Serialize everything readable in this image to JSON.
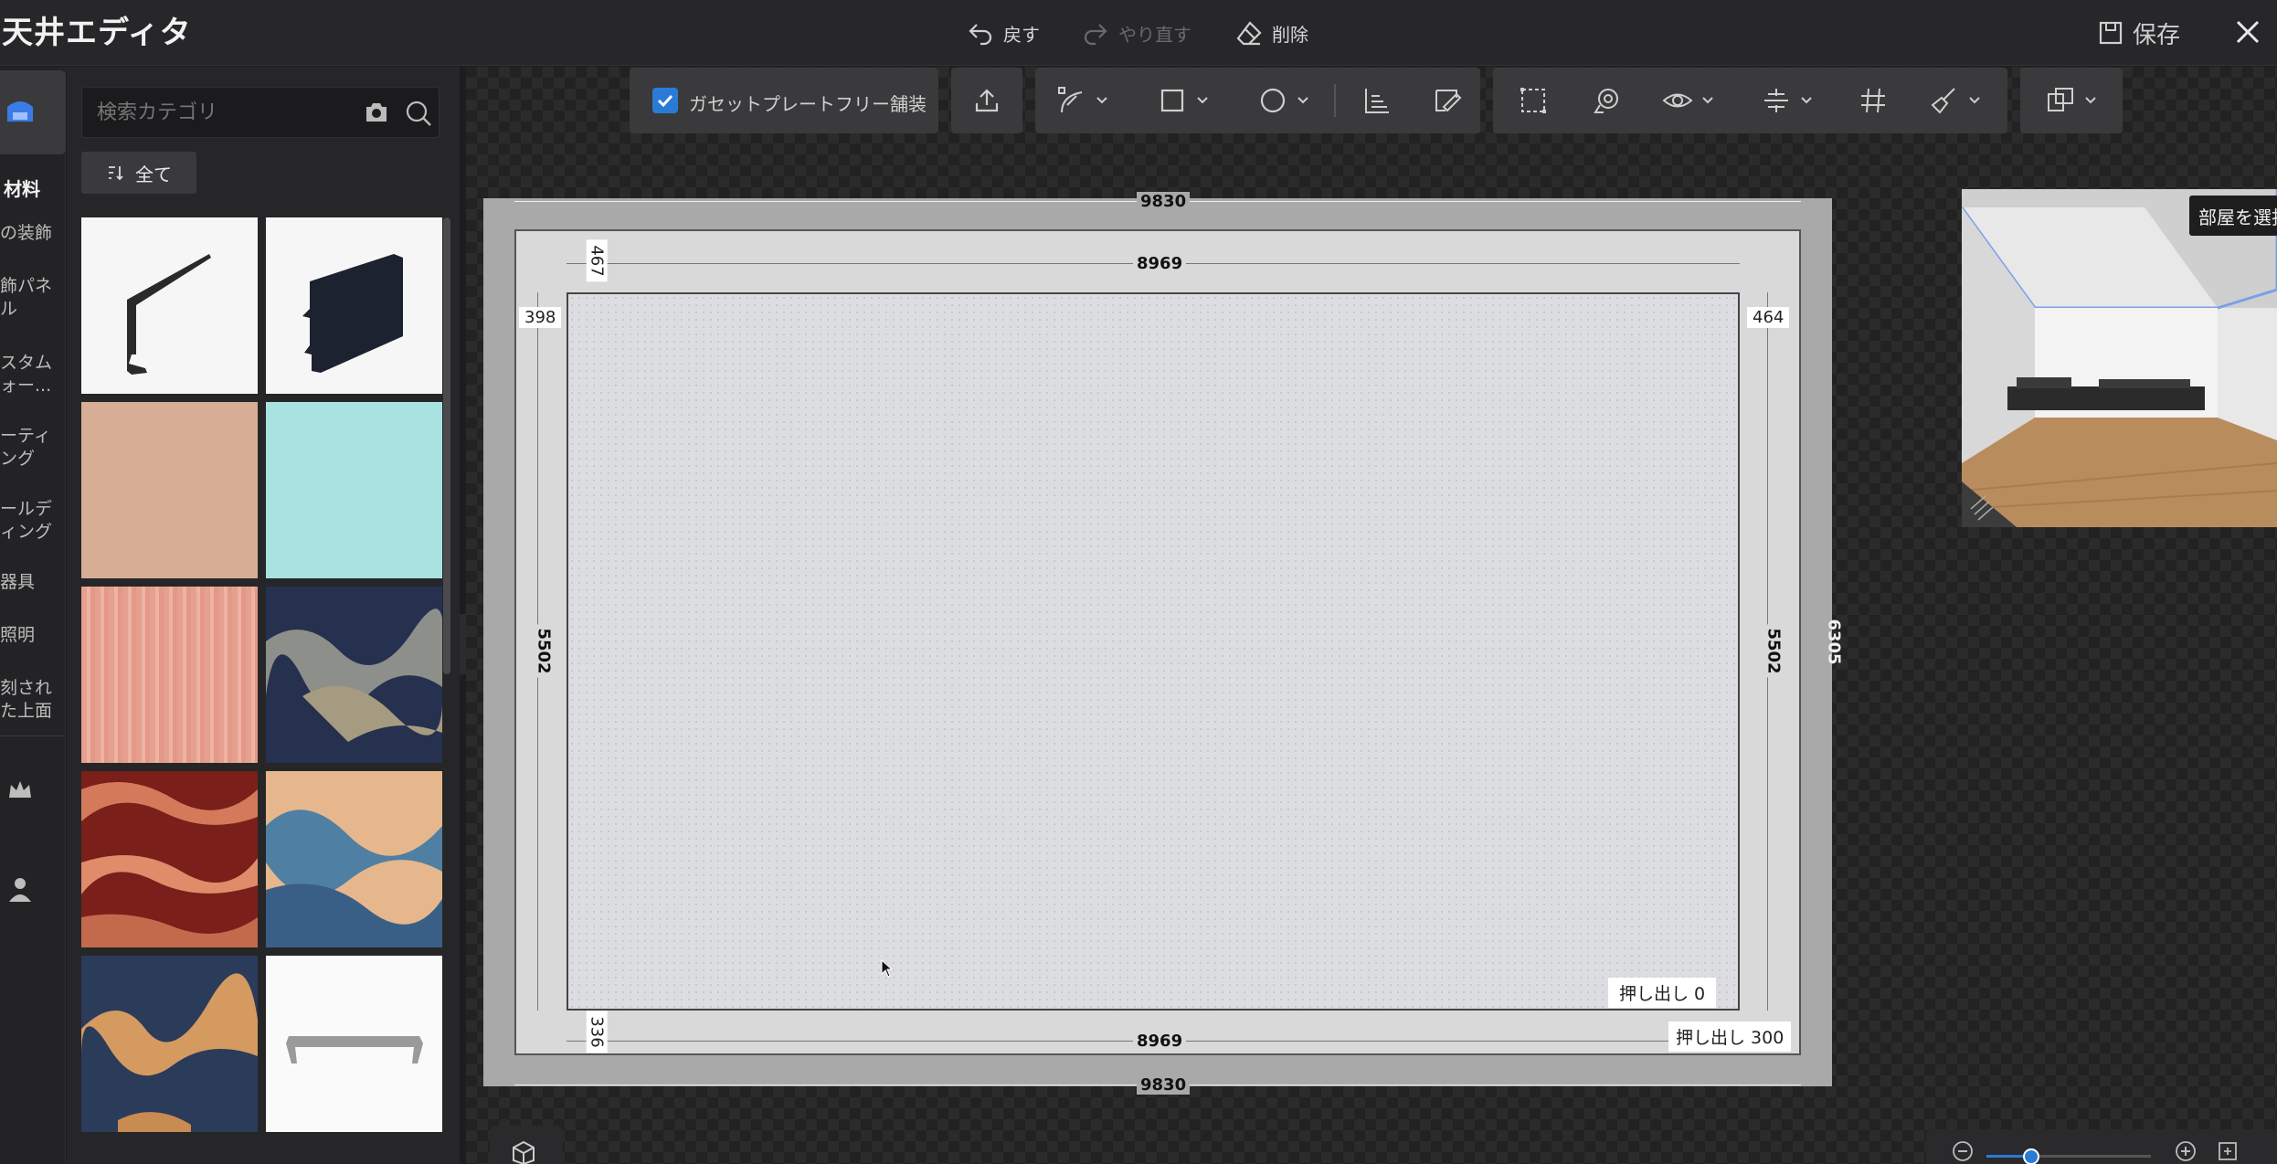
{
  "app": {
    "title": "天井エディタ"
  },
  "topbar": {
    "undo_label": "戻す",
    "redo_label": "やり直す",
    "delete_label": "削除",
    "save_label": "保存"
  },
  "rail": {
    "active_label": "材料",
    "items": [
      {
        "label": "の装飾"
      },
      {
        "label": "飾パネ\nル"
      },
      {
        "label": "スタム\nォー..."
      },
      {
        "label": "ーティ\nング"
      },
      {
        "label": "ールデ\nィング"
      },
      {
        "label": "器具"
      },
      {
        "label": "照明"
      },
      {
        "label": "刻され\nた上面"
      }
    ]
  },
  "panel": {
    "search_placeholder": "検索カテゴリ",
    "filter_label": "全て"
  },
  "toolbar": {
    "gusset_label": "ガセットプレートフリー舗装",
    "gusset_checked": true
  },
  "plan": {
    "dims": {
      "outer_top": "9830",
      "outer_bottom": "9830",
      "inner_top": "8969",
      "inner_bottom": "8969",
      "left_height": "5502",
      "right_height": "5502",
      "outer_right": "6305",
      "top_offset": "467",
      "bottom_offset": "336",
      "left_offset": "398",
      "right_offset": "464"
    },
    "extrude_inner": "押し出し  0",
    "extrude_outer": "押し出し  300"
  },
  "preview": {
    "tooltip": "部屋を選択"
  },
  "colors": {
    "accent": "#2a7bd6",
    "topbar": "#27272a",
    "panel": "#262628"
  }
}
